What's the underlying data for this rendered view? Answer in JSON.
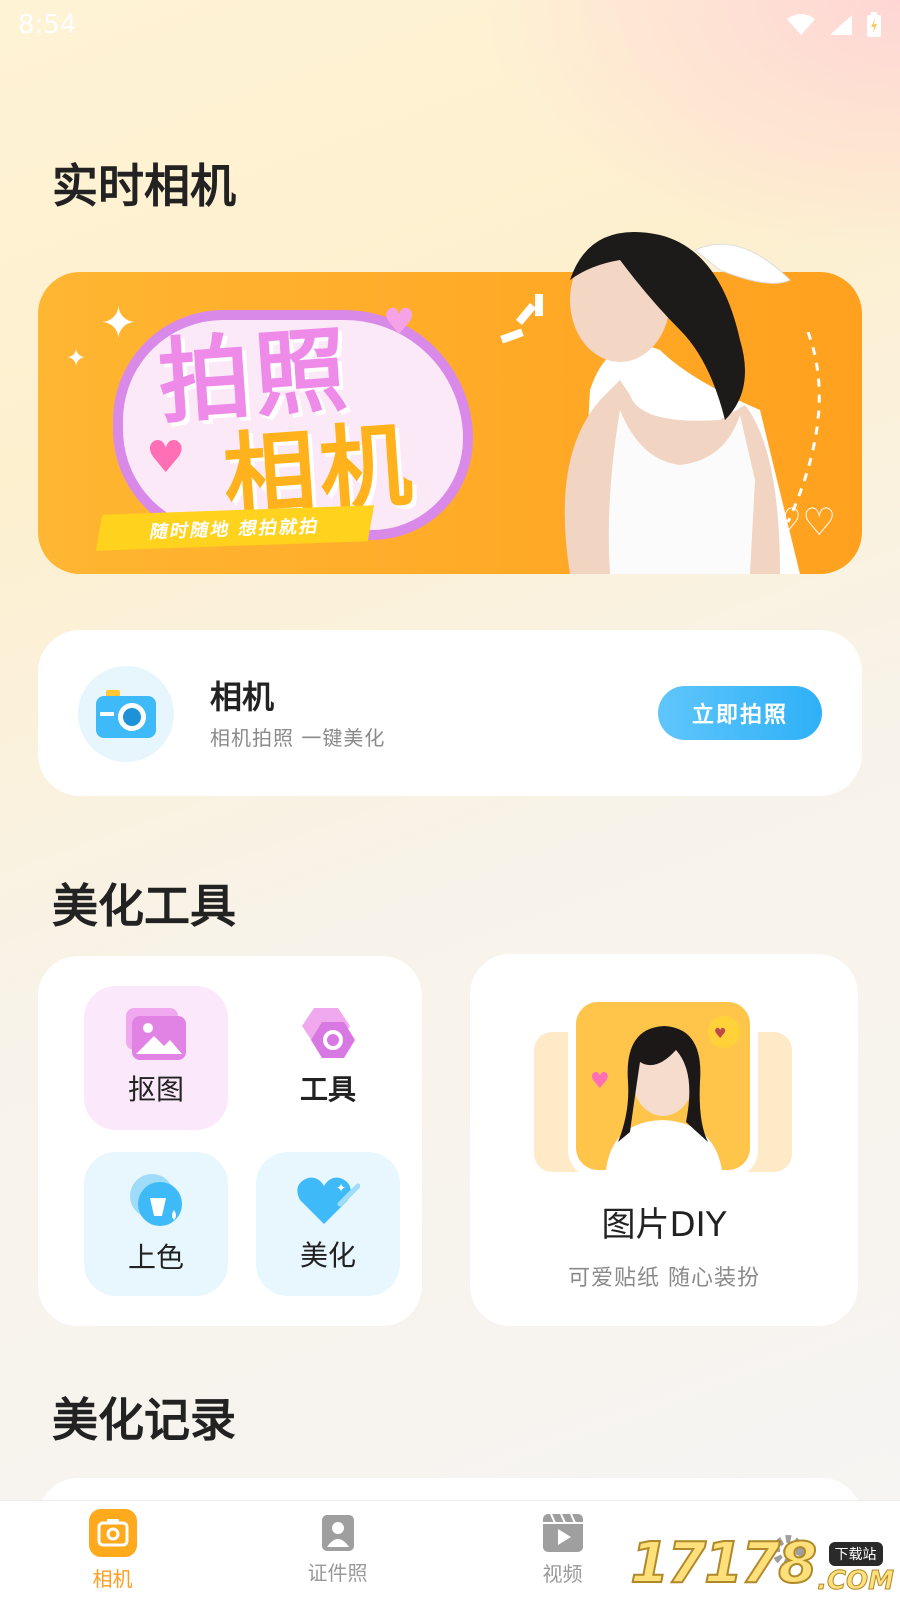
{
  "status_bar": {
    "time": "8:54"
  },
  "sections": {
    "realtime_camera": "实时相机",
    "beauty_tools": "美化工具",
    "beauty_records": "美化记录"
  },
  "banner": {
    "title_line1": "拍照",
    "title_line2": "相机",
    "slogan": "随时随地 想拍就拍"
  },
  "camera_card": {
    "name": "相机",
    "subtitle": "相机拍照 一键美化",
    "button": "立即拍照"
  },
  "tools": [
    {
      "label": "抠图",
      "icon": "image-icon",
      "bg": "#fbe8fb"
    },
    {
      "label": "工具",
      "icon": "hexagon-gear-icon",
      "bg": "#ffffff"
    },
    {
      "label": "上色",
      "icon": "paint-bucket-icon",
      "bg": "#e8f6fd"
    },
    {
      "label": "美化",
      "icon": "heart-wand-icon",
      "bg": "#e8f6fd"
    }
  ],
  "diy_card": {
    "title": "图片DIY",
    "subtitle": "可爱贴纸 随心装扮"
  },
  "bottom_nav": [
    {
      "label": "相机",
      "icon": "camera-icon",
      "active": true
    },
    {
      "label": "证件照",
      "icon": "id-photo-icon",
      "active": false
    },
    {
      "label": "视频",
      "icon": "video-icon",
      "active": false
    }
  ],
  "watermark": {
    "number": "17178",
    "tag": "下载站",
    "suffix": ".COM"
  },
  "colors": {
    "accent": "#ff9d1c",
    "banner": "#ffa11f",
    "button": "#2fb0f7"
  }
}
